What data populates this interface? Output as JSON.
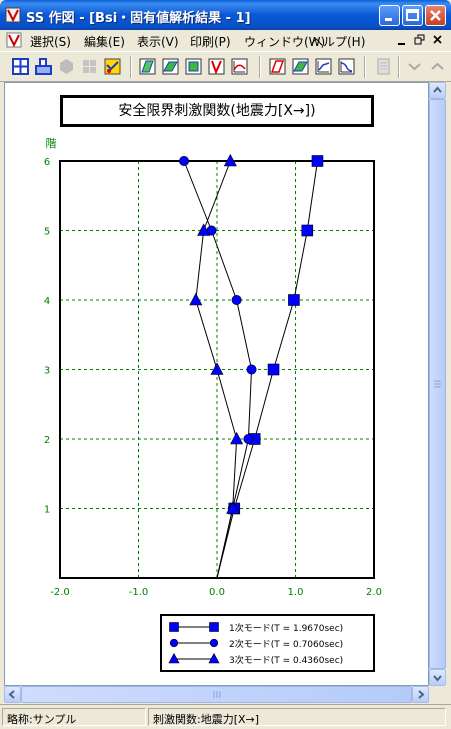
{
  "window": {
    "title": "SS 作図 - [Bsi・固有値解析結果 - 1]"
  },
  "menu": {
    "items": [
      "選択(S)",
      "編集(E)",
      "表示(V)",
      "印刷(P)",
      "ウィンドウ(W)",
      "ヘルプ(H)"
    ]
  },
  "statusbar": {
    "left": "略称:サンプル",
    "right": "刺激関数:地震力[X→]"
  },
  "chart_data": {
    "type": "line",
    "title": "安全限界刺激関数(地震力[X→])",
    "ylabel": "階",
    "xlabel": "",
    "xlim": [
      -2.0,
      2.0
    ],
    "ylim": [
      0,
      6
    ],
    "x_ticks": [
      "-2.0",
      "-1.0",
      "0.0",
      "1.0",
      "2.0"
    ],
    "y_ticks": [
      "1",
      "2",
      "3",
      "4",
      "5",
      "6"
    ],
    "grid": true,
    "legend_position": "bottom-right",
    "series": [
      {
        "name": "1次モード(T = 1.9670sec)",
        "marker": "square",
        "points": [
          [
            0.0,
            0
          ],
          [
            0.22,
            1
          ],
          [
            0.48,
            2
          ],
          [
            0.72,
            3
          ],
          [
            0.98,
            4
          ],
          [
            1.15,
            5
          ],
          [
            1.28,
            6
          ]
        ]
      },
      {
        "name": "2次モード(T = 0.7060sec)",
        "marker": "circle",
        "points": [
          [
            0.0,
            0
          ],
          [
            0.2,
            1
          ],
          [
            0.4,
            2
          ],
          [
            0.44,
            3
          ],
          [
            0.25,
            4
          ],
          [
            -0.07,
            5
          ],
          [
            -0.42,
            6
          ]
        ]
      },
      {
        "name": "3次モード(T = 0.4360sec)",
        "marker": "triangle",
        "points": [
          [
            0.0,
            0
          ],
          [
            0.2,
            1
          ],
          [
            0.25,
            2
          ],
          [
            0.0,
            3
          ],
          [
            -0.27,
            4
          ],
          [
            -0.17,
            5
          ],
          [
            0.17,
            6
          ]
        ]
      }
    ],
    "colors": {
      "series": "#0000ff",
      "marker_fill": "#0000ff",
      "axis_text": "#008000",
      "grid": "#008000"
    }
  }
}
